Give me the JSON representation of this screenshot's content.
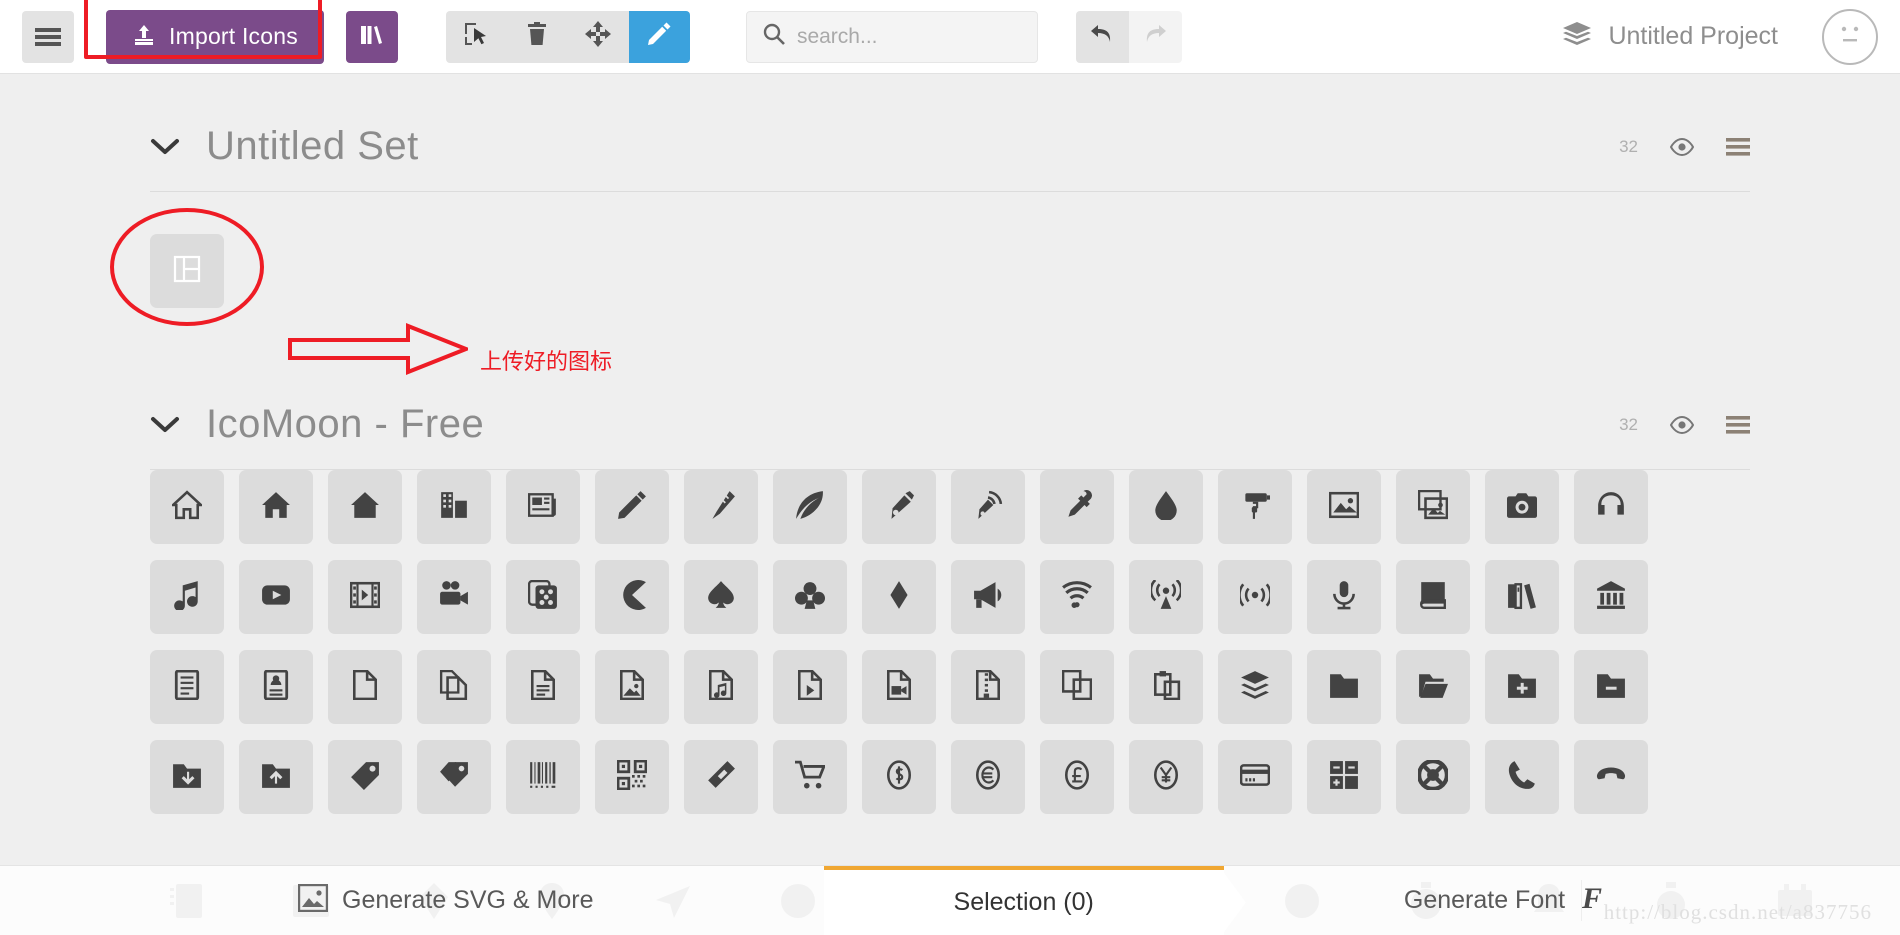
{
  "toolbar": {
    "menu_icon": "hamburger-menu-icon",
    "import_label": "Import Icons",
    "import_icon": "upload-icon",
    "library_icon": "books-icon",
    "tools": [
      {
        "name": "select-tool",
        "icon": "cursor-select-icon",
        "active": false
      },
      {
        "name": "delete-tool",
        "icon": "trash-icon",
        "active": false
      },
      {
        "name": "move-tool",
        "icon": "move-arrows-icon",
        "active": false
      },
      {
        "name": "edit-tool",
        "icon": "pencil-icon",
        "active": true
      }
    ],
    "search": {
      "placeholder": "search...",
      "value": "",
      "icon": "search-icon"
    },
    "undo_icon": "undo-arrow-icon",
    "redo_icon": "redo-arrow-icon",
    "project_icon": "layers-icon",
    "project_name": "Untitled Project",
    "avatar_icon": "neutral-face-icon",
    "accent_purple": "#7b4b8a",
    "accent_blue": "#3ba2dd"
  },
  "sets": [
    {
      "title": "Untitled Set",
      "count": "32",
      "chevron_icon": "chevron-down-icon",
      "eye_icon": "eye-icon",
      "menu_icon": "hamburger-menu-icon"
    },
    {
      "title": "IcoMoon - Free",
      "count": "32",
      "chevron_icon": "chevron-down-icon",
      "eye_icon": "eye-icon",
      "menu_icon": "hamburger-menu-icon"
    }
  ],
  "uploaded_icon": {
    "name": "layout-grid-icon"
  },
  "annotation": {
    "text": "上传好的图标",
    "color": "#ee1c25",
    "ellipse_target": "uploaded-icon",
    "rect_target": "import-icons-button",
    "arrow": "right-arrow"
  },
  "icon_grid": [
    [
      "home-icon",
      "home2-icon",
      "home3-icon",
      "office-icon",
      "newspaper-icon",
      "pencil-icon",
      "pencil2-icon",
      "quill-icon",
      "pen-icon",
      "blog-icon",
      "eyedropper-icon",
      "droplet-icon",
      "paint-format-icon",
      "image-icon",
      "images-icon",
      "camera-icon",
      "headphones-icon"
    ],
    [
      "music-icon",
      "play-icon",
      "film-icon",
      "video-camera-icon",
      "dice-icon",
      "pacman-icon",
      "spades-icon",
      "clubs-icon",
      "diamonds-icon",
      "bullhorn-icon",
      "connection-icon",
      "podcast-icon",
      "feed-icon",
      "mic-icon",
      "book-icon",
      "books-icon",
      "library-icon"
    ],
    [
      "file-text-icon",
      "profile-icon",
      "file-empty-icon",
      "files-empty-icon",
      "file-text2-icon",
      "file-picture-icon",
      "file-music-icon",
      "file-play-icon",
      "file-video-icon",
      "file-zip-icon",
      "copy-icon",
      "paste-icon",
      "stack-icon",
      "folder-icon",
      "folder-open-icon",
      "folder-plus-icon",
      "folder-minus-icon"
    ],
    [
      "folder-download-icon",
      "folder-upload-icon",
      "price-tag-icon",
      "price-tags-icon",
      "barcode-icon",
      "qrcode-icon",
      "ticket-icon",
      "cart-icon",
      "coin-dollar-icon",
      "coin-euro-icon",
      "coin-pound-icon",
      "coin-yen-icon",
      "credit-card-icon",
      "calculator-icon",
      "lifebuoy-icon",
      "phone-icon",
      "phone-hang-up-icon"
    ]
  ],
  "bottombar": {
    "left_label": "Generate SVG & More",
    "left_icon": "image-icon",
    "center_label": "Selection (0)",
    "right_label": "Generate Font",
    "right_icon": "font-f-icon",
    "active_tab": "center",
    "active_color": "#f0a732",
    "watermark": "http://blog.csdn.net/a837756"
  }
}
